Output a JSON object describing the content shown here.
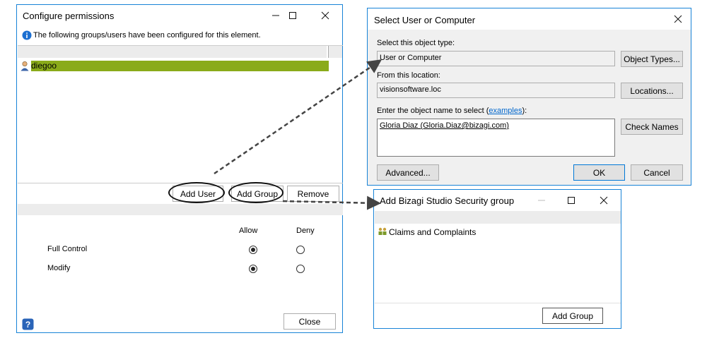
{
  "configure": {
    "title": "Configure permissions",
    "info_text": "The following groups/users have been configured for this element.",
    "users": [
      {
        "name": "diegoo",
        "selected": true
      }
    ],
    "add_user_label": "Add User",
    "add_group_label": "Add Group",
    "remove_label": "Remove",
    "allow_label": "Allow",
    "deny_label": "Deny",
    "permissions": [
      {
        "name": "Full Control",
        "allow": true,
        "deny": false
      },
      {
        "name": "Modify",
        "allow": true,
        "deny": false
      }
    ],
    "close_label": "Close"
  },
  "select_user": {
    "title": "Select User or Computer",
    "object_type_label": "Select this object type:",
    "object_type_value": "User or Computer",
    "object_types_button": "Object Types...",
    "location_label": "From this location:",
    "location_value": "visionsoftware.loc",
    "locations_button": "Locations...",
    "enter_name_prefix": "Enter the object name to select (",
    "examples_link": "examples",
    "enter_name_suffix": "):",
    "object_name_value": "Gloria Diaz (Gloria.Diaz@bizagi.com)",
    "check_names_button": "Check Names",
    "advanced_button": "Advanced...",
    "ok_button": "OK",
    "cancel_button": "Cancel"
  },
  "security_group": {
    "title": "Add Bizagi Studio Security group",
    "groups": [
      "Claims and Complaints"
    ],
    "add_group_button": "Add Group"
  },
  "colors": {
    "selection_green": "#8aab1a",
    "window_border": "#1883d7",
    "link_blue": "#0066cc"
  }
}
